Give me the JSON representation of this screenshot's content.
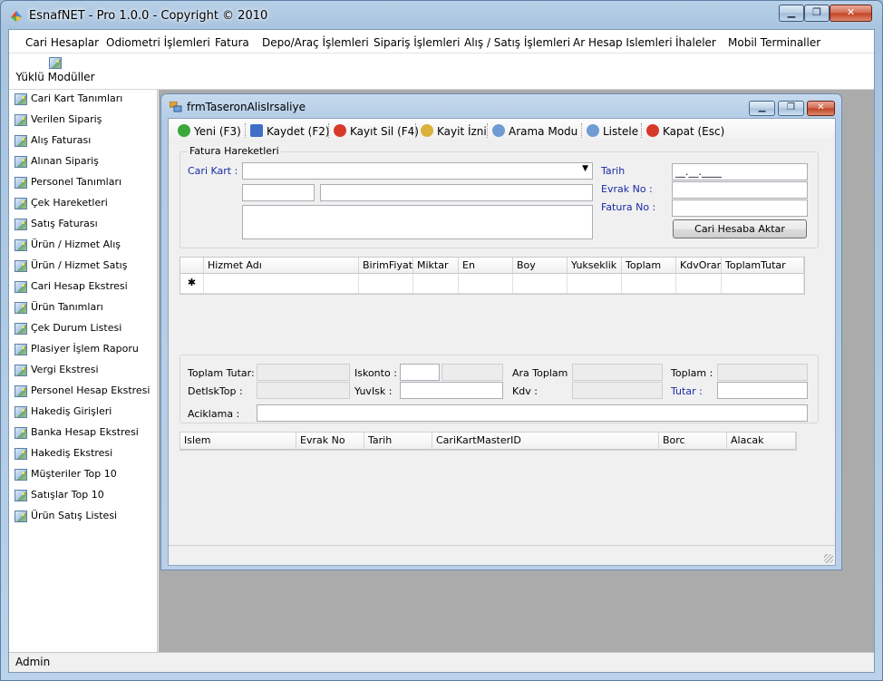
{
  "app": {
    "title": "EsnafNET - Pro 1.0.0 - Copyright ©  2010",
    "min_symbol": "▁",
    "max_symbol": "❐",
    "close_symbol": "✕"
  },
  "menu": [
    "Cari Hesaplar",
    "Odiometri İşlemleri",
    "Fatura",
    "Depo/Araç İşlemleri",
    "Sipariş İşlemleri",
    "Alış / Satış İşlemleri",
    "Ar Hesap Islemleri",
    "İhaleler",
    "Mobil Terminaller"
  ],
  "toolstrip": {
    "modules_label": "Yüklü Modüller"
  },
  "sidebar": [
    "Cari Kart Tanımları",
    "Verilen Sipariş",
    "Alış Faturası",
    "Alınan Sipariş",
    "Personel Tanımları",
    "Çek Hareketleri",
    "Satış Faturası",
    "Ürün / Hizmet Alış",
    "Ürün / Hizmet Satış",
    "Cari Hesap Ekstresi",
    "Ürün Tanımları",
    "Çek Durum Listesi",
    "Plasiyer İşlem Raporu",
    "Vergi Ekstresi",
    "Personel Hesap Ekstresi",
    "Hakediş Girişleri",
    "Banka Hesap Ekstresi",
    "Hakediş Ekstresi",
    "Müşteriler Top 10",
    "Satışlar Top 10",
    "Ürün Satış Listesi"
  ],
  "status": {
    "user": "Admin"
  },
  "child": {
    "title": "frmTaseronAlisIrsaliye",
    "toolbar": [
      {
        "label": "Yeni (F3)",
        "color": "#3aa83a"
      },
      {
        "label": "Kaydet (F2)",
        "color": "#3f6fc6"
      },
      {
        "label": "Kayıt Sil (F4)",
        "color": "#d83a2a"
      },
      {
        "label": "Kayit İzni",
        "color": "#d9b23a"
      },
      {
        "label": "Arama Modu",
        "color": "#6f9bd3"
      },
      {
        "label": "Listele",
        "color": "#6f9bd3"
      },
      {
        "label": "Kapat (Esc)",
        "color": "#d83a2a"
      }
    ],
    "fatura": {
      "group_title": "Fatura Hareketleri",
      "cari_kart_label": "Cari Kart :",
      "cari_kart_value": "",
      "tarih_label": "Tarih",
      "tarih_value": "__.__.____",
      "evrak_label": "Evrak No :",
      "evrak_value": "",
      "fatura_no_label": "Fatura No :",
      "fatura_no_value": "",
      "aktar_button": "Cari Hesaba Aktar"
    },
    "grid_columns": [
      "Hizmet Adı",
      "BirimFiyat",
      "Miktar",
      "En",
      "Boy",
      "Yukseklik",
      "Toplam",
      "KdvOran",
      "ToplamTutar"
    ],
    "new_row_marker": "✱",
    "totals": {
      "toplam_tutar_label": "Toplam Tutar:",
      "iskonto_label": "Iskonto :",
      "ara_toplam_label": "Ara Toplam :",
      "toplam_label": "Toplam :",
      "detisktop_label": "DetIskTop :",
      "yuvisk_label": "YuvIsk :",
      "kdv_label": "Kdv :",
      "tutar_label": "Tutar :",
      "aciklama_label": "Aciklama :"
    },
    "bottom_columns": [
      "Islem",
      "Evrak No",
      "Tarih",
      "CariKartMasterID",
      "Borc",
      "Alacak"
    ]
  }
}
